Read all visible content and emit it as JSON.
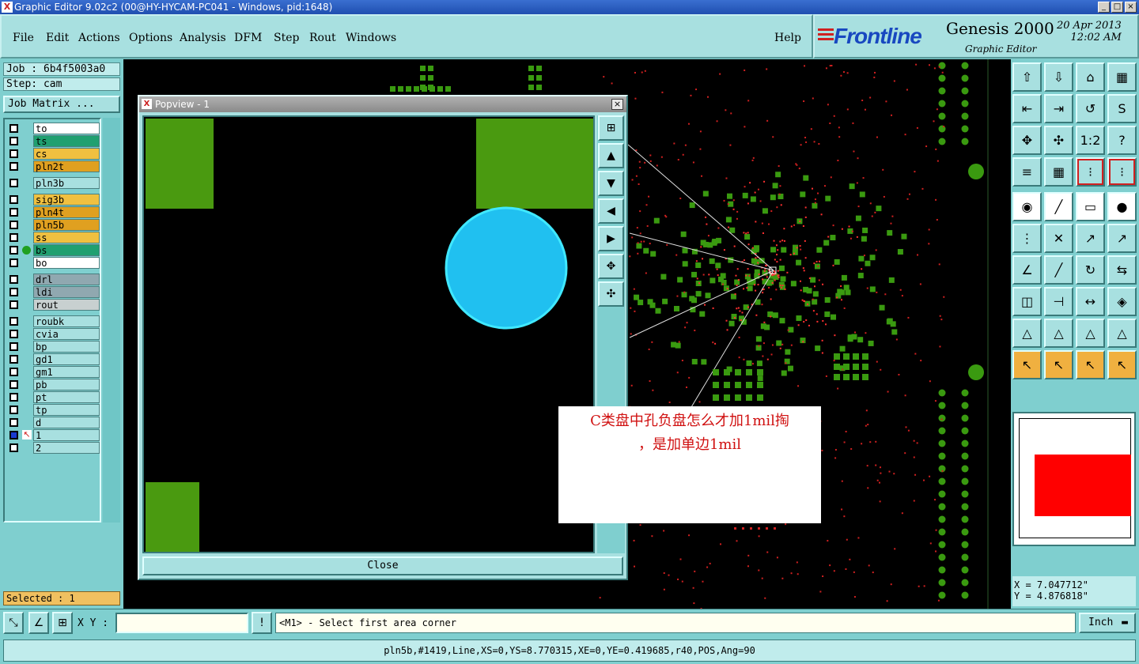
{
  "window": {
    "title": "Graphic Editor 9.02c2 (00@HY-HYCAM-PC041 - Windows, pid:1648)",
    "controls": [
      "_",
      "□",
      "×"
    ]
  },
  "menu": {
    "items": [
      "File",
      "Edit",
      "Actions",
      "Options",
      "Analysis",
      "DFM",
      "Step",
      "Rout",
      "Windows"
    ],
    "help": "Help"
  },
  "brand": {
    "logo": "Frontline",
    "product": "Genesis 2000",
    "module": "Graphic Editor",
    "date": "20 Apr 2013",
    "time": "12:02 AM"
  },
  "job": {
    "job_line": "Job : 6b4f5003a0",
    "step_line": "Step: cam",
    "matrix_button": "Job Matrix ..."
  },
  "layers": [
    {
      "name": "to",
      "color": "#ffffff"
    },
    {
      "name": "ts",
      "color": "#20a070"
    },
    {
      "name": "cs",
      "color": "#f0c040"
    },
    {
      "name": "pln2t",
      "color": "#e0a020"
    },
    {
      "name": "pln3b",
      "color": "#a8e0e0"
    },
    {
      "name": "sig3b",
      "color": "#f0c040"
    },
    {
      "name": "pln4t",
      "color": "#e0a020"
    },
    {
      "name": "pln5b",
      "color": "#e0a020"
    },
    {
      "name": "ss",
      "color": "#f0c040"
    },
    {
      "name": "bs",
      "color": "#20a070"
    },
    {
      "name": "bo",
      "color": "#ffffff"
    },
    {
      "name": "drl",
      "color": "#90a8b0"
    },
    {
      "name": "ldi",
      "color": "#90a8b0"
    },
    {
      "name": "rout",
      "color": "#c8d0d0"
    },
    {
      "name": "roubk",
      "color": "#a8e0e0"
    },
    {
      "name": "cvia",
      "color": "#a8e0e0"
    },
    {
      "name": "bp",
      "color": "#a8e0e0"
    },
    {
      "name": "gd1",
      "color": "#a8e0e0"
    },
    {
      "name": "gm1",
      "color": "#a8e0e0"
    },
    {
      "name": "pb",
      "color": "#a8e0e0"
    },
    {
      "name": "pt",
      "color": "#a8e0e0"
    },
    {
      "name": "tp",
      "color": "#a8e0e0"
    },
    {
      "name": "d",
      "color": "#a8e0e0"
    },
    {
      "name": "1",
      "color": "#a8e0e0"
    },
    {
      "name": "2",
      "color": "#a8e0e0"
    }
  ],
  "selected": "Selected : 1",
  "popview": {
    "title": "Popview - 1",
    "close_label": "Close"
  },
  "note": {
    "line1": "C类盘中孔负盘怎么才加1mil掏",
    "line2": "，是加单边1mil"
  },
  "toolbox_icons": [
    "home-icon",
    "save-icon",
    "house-icon",
    "grid-icon",
    "arrow-left-icon",
    "arrow-right-icon",
    "arrow-ring-icon",
    "s-curve-icon",
    "zoom-fit-icon",
    "zoom-center-icon",
    "ratio-icon",
    "help-icon",
    "cross-hatch-icon",
    "grid-icon",
    "traffic-icon",
    "traffic-alt-icon",
    "pad-add-icon",
    "line-add-icon",
    "ruler-icon",
    "circle-dot-icon",
    "nodes-icon",
    "delete-x-icon",
    "move-icon",
    "copy-move-icon",
    "angle-icon",
    "line-edit-icon",
    "rotate-icon",
    "mirror-icon",
    "snap-icon",
    "cut-icon",
    "measure-icon",
    "shape-icon",
    "tri-icon",
    "tri-alt-icon",
    "tri-mid-icon",
    "tri-end-icon",
    "select-icon",
    "select-box-icon",
    "select-net-icon",
    "select-path-icon"
  ],
  "labels": {
    "ratio": "1:2",
    "question": "?"
  },
  "coords": {
    "x": "X = 7.047712\"",
    "y": "Y = 4.876818\""
  },
  "cmd": {
    "xy_label": "X Y :",
    "xy_value": "",
    "prompt": "<M1> - Select first area corner",
    "units": "Inch"
  },
  "status": "pln5b,#1419,Line,XS=0,YS=8.770315,XE=0,YE=0.419685,r40,POS,Ang=90"
}
